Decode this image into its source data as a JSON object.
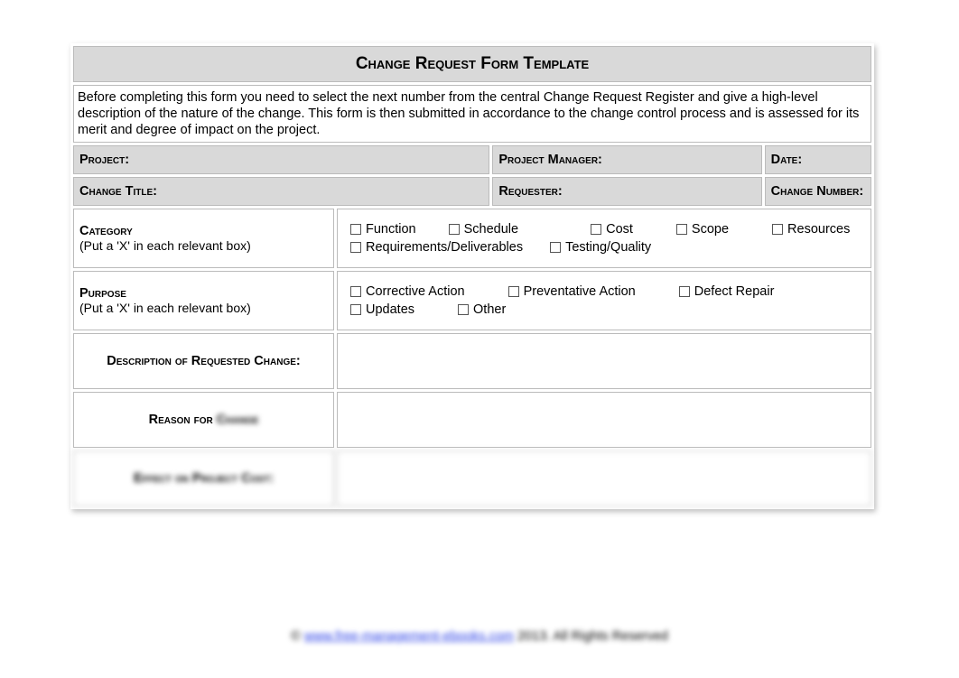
{
  "title": "Change Request Form Template",
  "intro": "Before completing this form you need to select the next number from the central Change Request Register and give a high-level description of the nature of the change. This form is then submitted in accordance to the change control process and is assessed for its merit and degree of impact on the project.",
  "fields": {
    "project": "Project:",
    "project_manager": "Project Manager:",
    "date": "Date:",
    "change_title": "Change Title:",
    "requester": "Requester:",
    "change_number": "Change Number:"
  },
  "category": {
    "label": "Category",
    "sub": "(Put a 'X' in each relevant box)",
    "options_row1": [
      "Function",
      "Schedule",
      "Cost",
      "Scope",
      "Resources"
    ],
    "options_row2": [
      "Requirements/Deliverables",
      "Testing/Quality"
    ]
  },
  "purpose": {
    "label": "Purpose",
    "sub": "(Put a 'X' in each relevant box)",
    "options_row1": [
      "Corrective Action",
      "Preventative Action",
      "Defect Repair"
    ],
    "options_row2": [
      "Updates",
      "Other"
    ]
  },
  "rows": {
    "description": "Description of Requested Change:",
    "reason_prefix": "Reason for",
    "reason_blur": "Change",
    "effect": "Effect on Project Cost:"
  },
  "footer": {
    "pre": "© ",
    "link": "www.free-management-ebooks.com",
    "post": " 2013. All Rights Reserved"
  }
}
